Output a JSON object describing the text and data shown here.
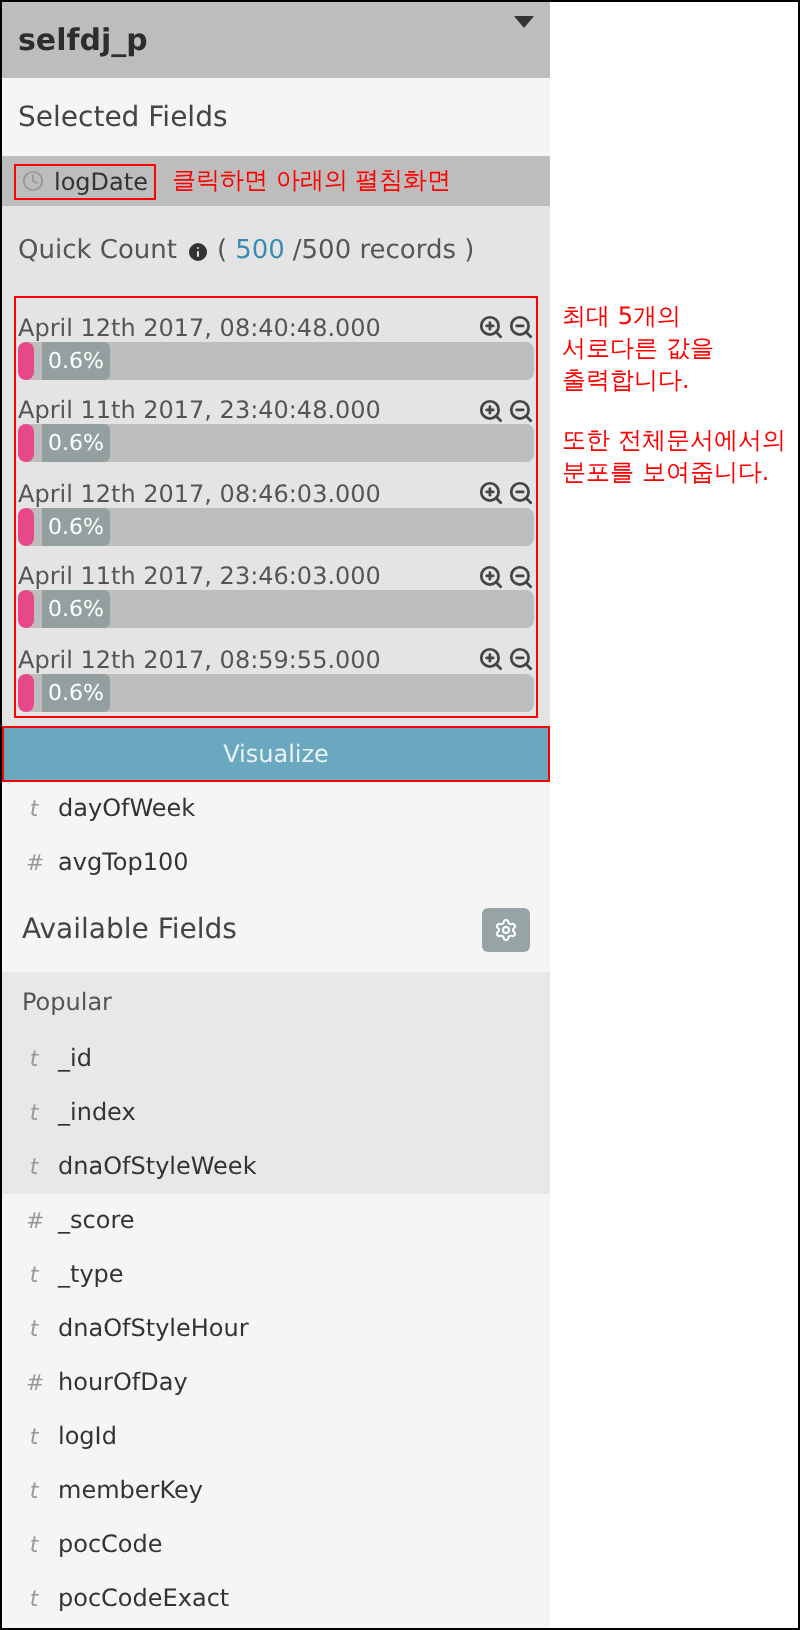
{
  "index_pattern": {
    "title": "selfdj_p"
  },
  "selected_fields": {
    "heading": "Selected Fields",
    "expanded_field": {
      "kind": "date",
      "name": "logDate",
      "annotation": "클릭하면 아래의 펼침화면"
    },
    "quick_count": {
      "label": "Quick Count",
      "open": "(",
      "count": "500",
      "rest": "/500 records )"
    },
    "top_values": [
      {
        "value": "April 12th 2017, 08:40:48.000",
        "percent": "0.6%",
        "level": 0.006
      },
      {
        "value": "April 11th 2017, 23:40:48.000",
        "percent": "0.6%",
        "level": 0.006
      },
      {
        "value": "April 12th 2017, 08:46:03.000",
        "percent": "0.6%",
        "level": 0.006
      },
      {
        "value": "April 11th 2017, 23:46:03.000",
        "percent": "0.6%",
        "level": 0.006
      },
      {
        "value": "April 12th 2017, 08:59:55.000",
        "percent": "0.6%",
        "level": 0.006
      }
    ],
    "values_annotation": [
      [
        "최대 5개의",
        "서로다른 값을",
        "출력합니다."
      ],
      [
        "또한 전체문서에서의",
        "분포를 보여줍니다."
      ]
    ],
    "visualize_button": "Visualize",
    "fields": [
      {
        "type": "t",
        "name": "dayOfWeek"
      },
      {
        "type": "#",
        "name": "avgTop100"
      }
    ]
  },
  "available_fields": {
    "heading": "Available Fields",
    "popular": {
      "label": "Popular",
      "fields": [
        {
          "type": "t",
          "name": "_id"
        },
        {
          "type": "t",
          "name": "_index"
        },
        {
          "type": "t",
          "name": "dnaOfStyleWeek"
        }
      ]
    },
    "fields": [
      {
        "type": "#",
        "name": "_score"
      },
      {
        "type": "t",
        "name": "_type"
      },
      {
        "type": "t",
        "name": "dnaOfStyleHour"
      },
      {
        "type": "#",
        "name": "hourOfDay"
      },
      {
        "type": "t",
        "name": "logId"
      },
      {
        "type": "t",
        "name": "memberKey"
      },
      {
        "type": "t",
        "name": "pocCode"
      },
      {
        "type": "t",
        "name": "pocCodeExact"
      }
    ]
  }
}
